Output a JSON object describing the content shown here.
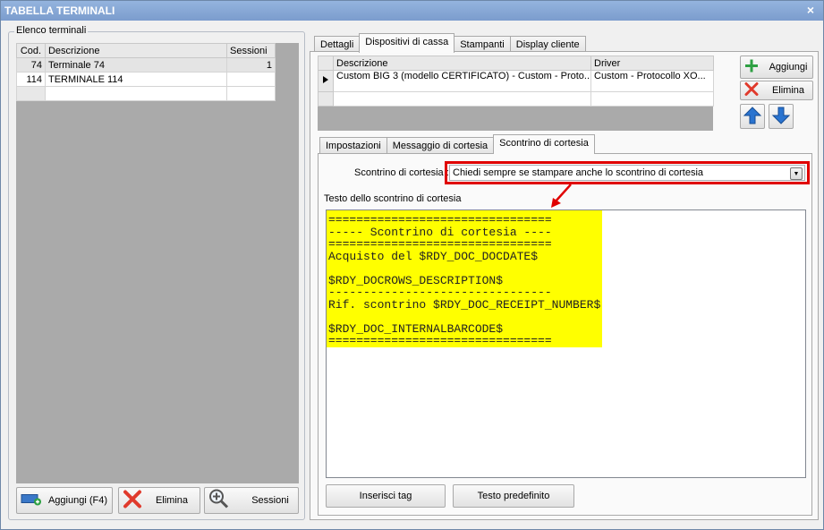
{
  "window": {
    "title": "TABELLA TERMINALI",
    "close_glyph": "×"
  },
  "left_group": {
    "legend": "Elenco terminali",
    "columns": [
      "Cod.",
      "Descrizione",
      "Sessioni"
    ],
    "rows": [
      {
        "cod": "74",
        "descrizione": "Terminale 74",
        "sessioni": "1"
      },
      {
        "cod": "114",
        "descrizione": "TERMINALE 114",
        "sessioni": ""
      }
    ],
    "buttons": {
      "add": "Aggiungi (F4)",
      "delete": "Elimina",
      "sessions": "Sessioni"
    }
  },
  "top_tabs": [
    "Dettagli",
    "Dispositivi di cassa",
    "Stampanti",
    "Display cliente"
  ],
  "devices": {
    "columns": [
      "Descrizione",
      "Driver"
    ],
    "rows": [
      {
        "descrizione": "Custom BIG 3 (modello CERTIFICATO) - Custom - Proto...",
        "driver": "Custom - Protocollo XO..."
      }
    ],
    "buttons": {
      "add": "Aggiungi",
      "delete": "Elimina"
    }
  },
  "sub_tabs": [
    "Impostazioni",
    "Messaggio di cortesia",
    "Scontrino di cortesia"
  ],
  "courtesy": {
    "combo_label": "Scontrino di cortesia :",
    "combo_value": "Chiedi sempre se stampare anche lo scontrino di cortesia",
    "text_label": "Testo dello scontrino di cortesia",
    "text_lines": [
      "================================",
      "----- Scontrino di cortesia ----",
      "================================",
      "Acquisto del $RDY_DOC_DOCDATE$",
      "",
      "$RDY_DOCROWS_DESCRIPTION$",
      "--------------------------------",
      "Rif. scontrino $RDY_DOC_RECEIPT_NUMBER$",
      "",
      "$RDY_DOC_INTERNALBARCODE$",
      "================================"
    ],
    "buttons": {
      "insert_tag": "Inserisci tag",
      "default_text": "Testo predefinito"
    }
  },
  "colors": {
    "title_bar": "#7b9ccd",
    "highlight": "#ffff00",
    "annotation": "#e00000",
    "grid_bg": "#aaaaaa"
  }
}
